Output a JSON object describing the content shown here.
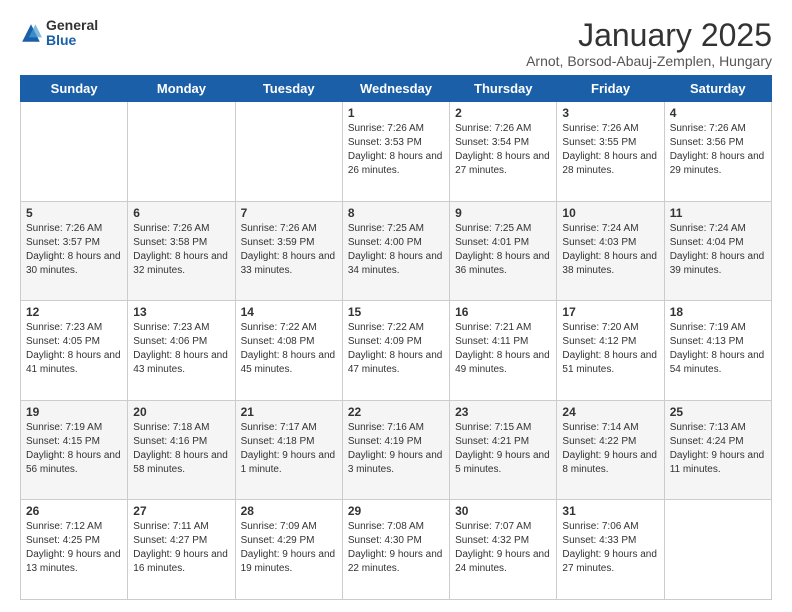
{
  "logo": {
    "general": "General",
    "blue": "Blue"
  },
  "header": {
    "month": "January 2025",
    "location": "Arnot, Borsod-Abauj-Zemplen, Hungary"
  },
  "weekdays": [
    "Sunday",
    "Monday",
    "Tuesday",
    "Wednesday",
    "Thursday",
    "Friday",
    "Saturday"
  ],
  "weeks": [
    [
      {
        "day": "",
        "info": ""
      },
      {
        "day": "",
        "info": ""
      },
      {
        "day": "",
        "info": ""
      },
      {
        "day": "1",
        "info": "Sunrise: 7:26 AM\nSunset: 3:53 PM\nDaylight: 8 hours and 26 minutes."
      },
      {
        "day": "2",
        "info": "Sunrise: 7:26 AM\nSunset: 3:54 PM\nDaylight: 8 hours and 27 minutes."
      },
      {
        "day": "3",
        "info": "Sunrise: 7:26 AM\nSunset: 3:55 PM\nDaylight: 8 hours and 28 minutes."
      },
      {
        "day": "4",
        "info": "Sunrise: 7:26 AM\nSunset: 3:56 PM\nDaylight: 8 hours and 29 minutes."
      }
    ],
    [
      {
        "day": "5",
        "info": "Sunrise: 7:26 AM\nSunset: 3:57 PM\nDaylight: 8 hours and 30 minutes."
      },
      {
        "day": "6",
        "info": "Sunrise: 7:26 AM\nSunset: 3:58 PM\nDaylight: 8 hours and 32 minutes."
      },
      {
        "day": "7",
        "info": "Sunrise: 7:26 AM\nSunset: 3:59 PM\nDaylight: 8 hours and 33 minutes."
      },
      {
        "day": "8",
        "info": "Sunrise: 7:25 AM\nSunset: 4:00 PM\nDaylight: 8 hours and 34 minutes."
      },
      {
        "day": "9",
        "info": "Sunrise: 7:25 AM\nSunset: 4:01 PM\nDaylight: 8 hours and 36 minutes."
      },
      {
        "day": "10",
        "info": "Sunrise: 7:24 AM\nSunset: 4:03 PM\nDaylight: 8 hours and 38 minutes."
      },
      {
        "day": "11",
        "info": "Sunrise: 7:24 AM\nSunset: 4:04 PM\nDaylight: 8 hours and 39 minutes."
      }
    ],
    [
      {
        "day": "12",
        "info": "Sunrise: 7:23 AM\nSunset: 4:05 PM\nDaylight: 8 hours and 41 minutes."
      },
      {
        "day": "13",
        "info": "Sunrise: 7:23 AM\nSunset: 4:06 PM\nDaylight: 8 hours and 43 minutes."
      },
      {
        "day": "14",
        "info": "Sunrise: 7:22 AM\nSunset: 4:08 PM\nDaylight: 8 hours and 45 minutes."
      },
      {
        "day": "15",
        "info": "Sunrise: 7:22 AM\nSunset: 4:09 PM\nDaylight: 8 hours and 47 minutes."
      },
      {
        "day": "16",
        "info": "Sunrise: 7:21 AM\nSunset: 4:11 PM\nDaylight: 8 hours and 49 minutes."
      },
      {
        "day": "17",
        "info": "Sunrise: 7:20 AM\nSunset: 4:12 PM\nDaylight: 8 hours and 51 minutes."
      },
      {
        "day": "18",
        "info": "Sunrise: 7:19 AM\nSunset: 4:13 PM\nDaylight: 8 hours and 54 minutes."
      }
    ],
    [
      {
        "day": "19",
        "info": "Sunrise: 7:19 AM\nSunset: 4:15 PM\nDaylight: 8 hours and 56 minutes."
      },
      {
        "day": "20",
        "info": "Sunrise: 7:18 AM\nSunset: 4:16 PM\nDaylight: 8 hours and 58 minutes."
      },
      {
        "day": "21",
        "info": "Sunrise: 7:17 AM\nSunset: 4:18 PM\nDaylight: 9 hours and 1 minute."
      },
      {
        "day": "22",
        "info": "Sunrise: 7:16 AM\nSunset: 4:19 PM\nDaylight: 9 hours and 3 minutes."
      },
      {
        "day": "23",
        "info": "Sunrise: 7:15 AM\nSunset: 4:21 PM\nDaylight: 9 hours and 5 minutes."
      },
      {
        "day": "24",
        "info": "Sunrise: 7:14 AM\nSunset: 4:22 PM\nDaylight: 9 hours and 8 minutes."
      },
      {
        "day": "25",
        "info": "Sunrise: 7:13 AM\nSunset: 4:24 PM\nDaylight: 9 hours and 11 minutes."
      }
    ],
    [
      {
        "day": "26",
        "info": "Sunrise: 7:12 AM\nSunset: 4:25 PM\nDaylight: 9 hours and 13 minutes."
      },
      {
        "day": "27",
        "info": "Sunrise: 7:11 AM\nSunset: 4:27 PM\nDaylight: 9 hours and 16 minutes."
      },
      {
        "day": "28",
        "info": "Sunrise: 7:09 AM\nSunset: 4:29 PM\nDaylight: 9 hours and 19 minutes."
      },
      {
        "day": "29",
        "info": "Sunrise: 7:08 AM\nSunset: 4:30 PM\nDaylight: 9 hours and 22 minutes."
      },
      {
        "day": "30",
        "info": "Sunrise: 7:07 AM\nSunset: 4:32 PM\nDaylight: 9 hours and 24 minutes."
      },
      {
        "day": "31",
        "info": "Sunrise: 7:06 AM\nSunset: 4:33 PM\nDaylight: 9 hours and 27 minutes."
      },
      {
        "day": "",
        "info": ""
      }
    ]
  ]
}
